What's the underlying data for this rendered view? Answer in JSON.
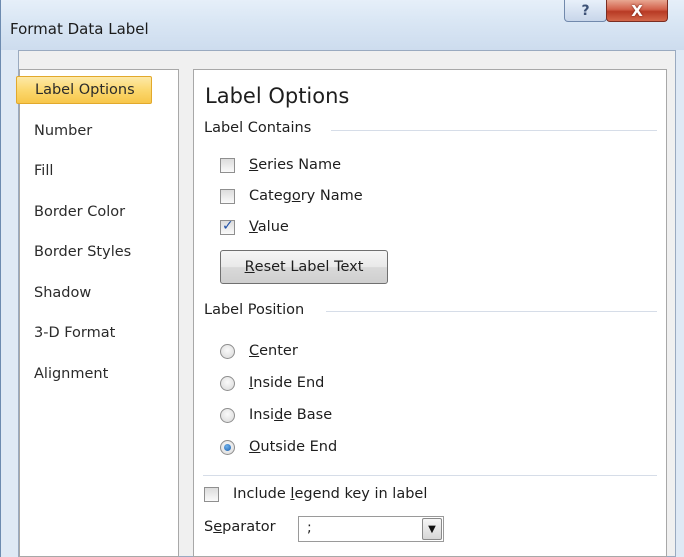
{
  "window": {
    "title": "Format Data Label",
    "help_symbol": "?",
    "close_symbol": "X"
  },
  "sidebar": {
    "items": [
      {
        "label": "Label Options",
        "selected": true
      },
      {
        "label": "Number"
      },
      {
        "label": "Fill"
      },
      {
        "label": "Border Color"
      },
      {
        "label": "Border Styles"
      },
      {
        "label": "Shadow"
      },
      {
        "label": "3-D Format"
      },
      {
        "label": "Alignment"
      }
    ]
  },
  "panel": {
    "title": "Label Options",
    "label_contains": {
      "heading": "Label Contains",
      "options": [
        {
          "pre": "",
          "key": "S",
          "post": "eries Name",
          "checked": false
        },
        {
          "pre": "Categ",
          "key": "o",
          "post": "ry Name",
          "checked": false
        },
        {
          "pre": "",
          "key": "V",
          "post": "alue",
          "checked": true
        }
      ],
      "reset_button": {
        "pre": "",
        "key": "R",
        "post": "eset Label Text"
      }
    },
    "label_position": {
      "heading": "Label Position",
      "options": [
        {
          "pre": "",
          "key": "C",
          "post": "enter",
          "selected": false
        },
        {
          "pre": "",
          "key": "I",
          "post": "nside End",
          "selected": false
        },
        {
          "pre": "Insi",
          "key": "d",
          "post": "e Base",
          "selected": false
        },
        {
          "pre": "",
          "key": "O",
          "post": "utside End",
          "selected": true
        }
      ]
    },
    "legend_key": {
      "pre": "Include ",
      "key": "l",
      "post": "egend key in label",
      "checked": false
    },
    "separator": {
      "pre": "S",
      "key": "e",
      "post": "parator",
      "value": ";"
    }
  },
  "colors": {
    "selected_tab": "#fbd86f",
    "checkbox_check": "#2353a8",
    "close_button": "#c9503a"
  }
}
